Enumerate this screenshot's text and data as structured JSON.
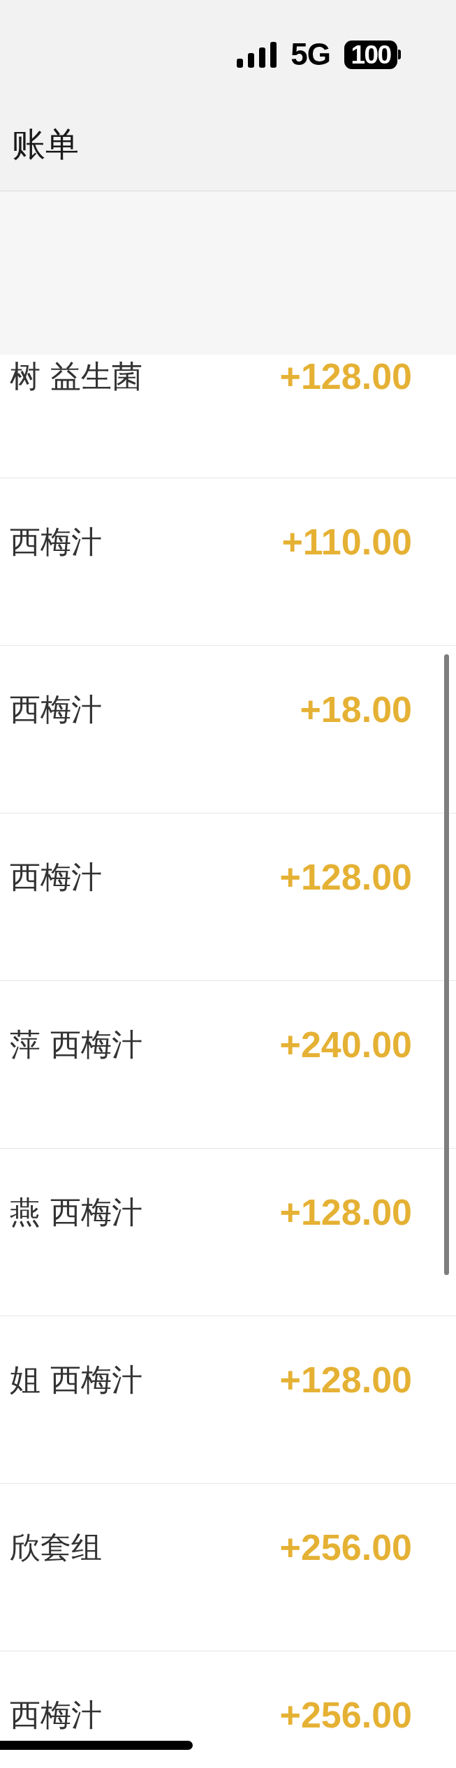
{
  "status_bar": {
    "network": "5G",
    "battery": "100"
  },
  "title": "账单",
  "transactions": [
    {
      "name": "树 益生菌",
      "amount": "+128.00"
    },
    {
      "name": "西梅汁",
      "amount": "+110.00"
    },
    {
      "name": "西梅汁",
      "amount": "+18.00"
    },
    {
      "name": "西梅汁",
      "amount": "+128.00"
    },
    {
      "name": "萍 西梅汁",
      "amount": "+240.00"
    },
    {
      "name": "燕 西梅汁",
      "amount": "+128.00"
    },
    {
      "name": "姐 西梅汁",
      "amount": "+128.00"
    },
    {
      "name": "欣套组",
      "amount": "+256.00"
    },
    {
      "name": "西梅汁",
      "amount": "+256.00"
    }
  ]
}
